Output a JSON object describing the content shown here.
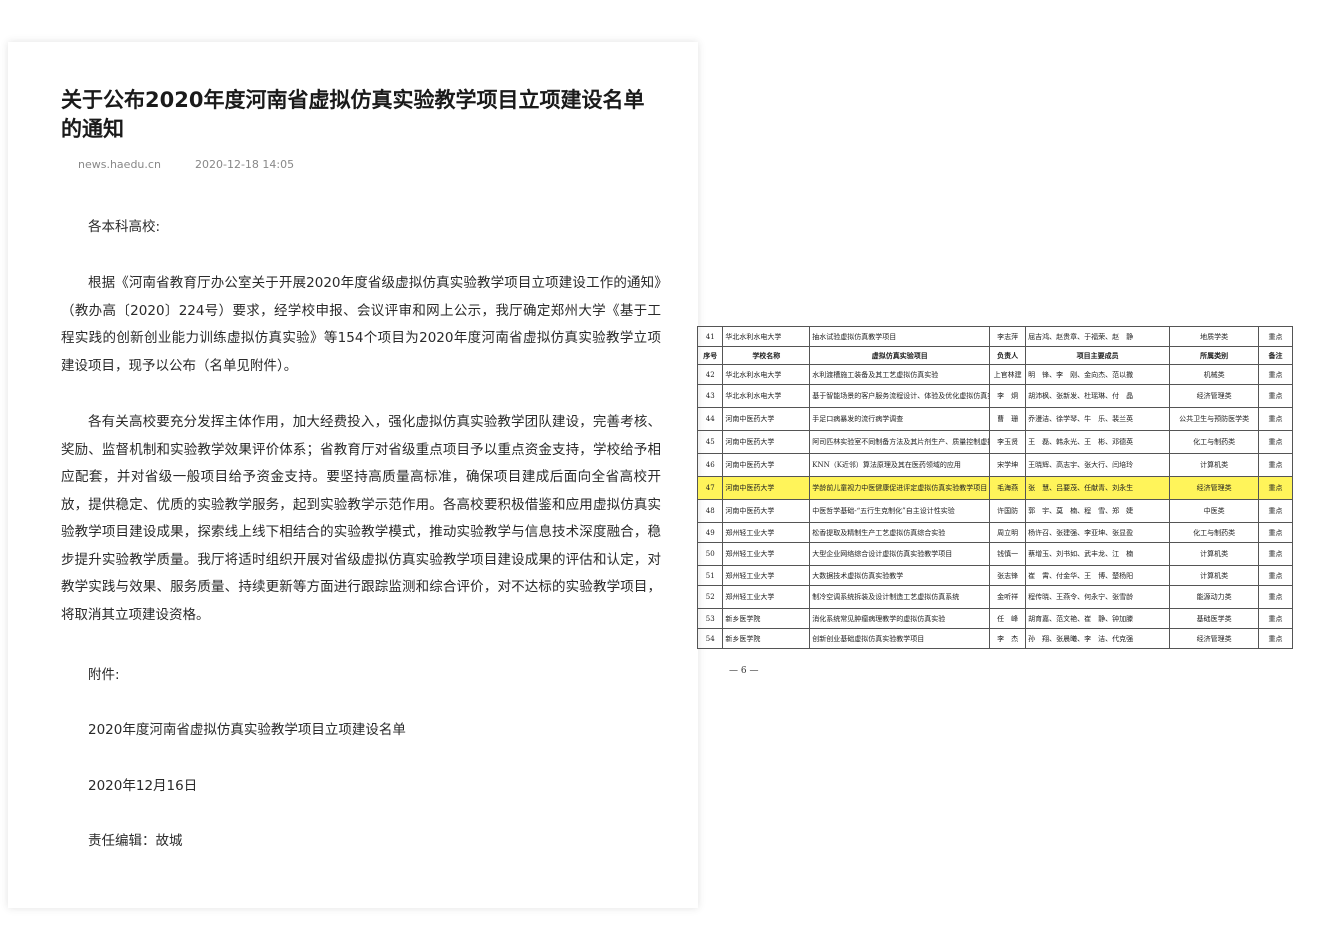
{
  "article": {
    "title": "关于公布2020年度河南省虚拟仿真实验教学项目立项建设名单的通知",
    "source": "news.haedu.cn",
    "datetime": "2020-12-18 14:05",
    "salutation": "各本科高校:",
    "para1": "根据《河南省教育厅办公室关于开展2020年度省级虚拟仿真实验教学项目立项建设工作的通知》（教办高〔2020〕224号）要求，经学校申报、会议评审和网上公示，我厅确定郑州大学《基于工程实践的创新创业能力训练虚拟仿真实验》等154个项目为2020年度河南省虚拟仿真实验教学立项建设项目，现予以公布（名单见附件）。",
    "para2": "各有关高校要充分发挥主体作用，加大经费投入，强化虚拟仿真实验教学团队建设，完善考核、奖励、监督机制和实验教学效果评价体系；省教育厅对省级重点项目予以重点资金支持，学校给予相应配套，并对省级一般项目给予资金支持。要坚持高质量高标准，确保项目建成后面向全省高校开放，提供稳定、优质的实验教学服务，起到实验教学示范作用。各高校要积极借鉴和应用虚拟仿真实验教学项目建设成果，探索线上线下相结合的实验教学模式，推动实验教学与信息技术深度融合，稳步提升实验教学质量。我厅将适时组织开展对省级虚拟仿真实验教学项目建设成果的评估和认定，对教学实践与效果、服务质量、持续更新等方面进行跟踪监测和综合评价，对不达标的实验教学项目，将取消其立项建设资格。",
    "attachment_label": "附件:",
    "attachment_name": "2020年度河南省虚拟仿真实验教学项目立项建设名单",
    "sign_date": "2020年12月16日",
    "editor": "责任编辑：故城"
  },
  "table": {
    "headers": [
      "序号",
      "学校名称",
      "虚拟仿真实验项目",
      "负责人",
      "项目主要成员",
      "所属类别",
      "备注"
    ],
    "top_row": [
      "41",
      "华北水利水电大学",
      "抽水试验虚拟仿真教学项目",
      "李志萍",
      "屈吉鸿、赵贵章、于福荣、赵　静",
      "地质学类",
      "重点"
    ],
    "rows": [
      [
        "42",
        "华北水利水电大学",
        "水利渡槽施工装备及其工艺虚拟仿真实验",
        "上官林建",
        "明　锋、李　刚、金向杰、范以撒",
        "机械类",
        "重点"
      ],
      [
        "43",
        "华北水利水电大学",
        "基于智能场景的客户服务流程设计、体验及优化虚拟仿真实验项目",
        "李　炯",
        "胡沛枫、张新发、杜瑶琳、付　晶",
        "经济管理类",
        "重点"
      ],
      [
        "44",
        "河南中医药大学",
        "手足口病暴发的流行病学调查",
        "曹　珊",
        "乔漫洁、徐学琴、牛　乐、裴兰英",
        "公共卫生与预防医学类",
        "重点"
      ],
      [
        "45",
        "河南中医药大学",
        "阿司匹林实验室不同制备方法及其片剂生产、质量控制虚拟仿真实验",
        "李玉贤",
        "王　磊、韩永光、王　彬、邓德英",
        "化工与制药类",
        "重点"
      ],
      [
        "46",
        "河南中医药大学",
        "KNN（K近邻）算法原理及其在医药领域的应用",
        "宋学坤",
        "王晓辉、高志宇、张大行、闫培玲",
        "计算机类",
        "重点"
      ],
      [
        "47",
        "河南中医药大学",
        "学龄前儿童视力中医健康促进评定虚拟仿真实验教学项目",
        "毛海燕",
        "张　慧、吕要茂、任献青、刘永生",
        "经济管理类",
        "重点"
      ],
      [
        "48",
        "河南中医药大学",
        "中医哲学基础-“五行生克制化”自主设计性实验",
        "许国防",
        "郭　宇、莫　楠、程　雪、郑　婕",
        "中医类",
        "重点"
      ],
      [
        "49",
        "郑州轻工业大学",
        "松香提取及精制生产工艺虚拟仿真综合实验",
        "周立明",
        "杨许召、张建强、李亚坤、张显盈",
        "化工与制药类",
        "重点"
      ],
      [
        "50",
        "郑州轻工业大学",
        "大型企业网络综合设计虚拟仿真实验教学项目",
        "钱慎一",
        "蔡增玉、刘书如、武丰龙、江　楠",
        "计算机类",
        "重点"
      ],
      [
        "51",
        "郑州轻工业大学",
        "大数据技术虚拟仿真实验教学",
        "张志锋",
        "崔　霄、付金华、王　博、楚杨阳",
        "计算机类",
        "重点"
      ],
      [
        "52",
        "郑州轻工业大学",
        "制冷空调系统拆装及设计制造工艺虚拟仿真系统",
        "金听祥",
        "程传晓、王燕令、何永宁、张雪龄",
        "能源动力类",
        "重点"
      ],
      [
        "53",
        "新乡医学院",
        "消化系统常见肿瘤病理教学的虚拟仿真实验",
        "任　峰",
        "胡育嘉、范文艳、崔　静、钟加滕",
        "基础医学类",
        "重点"
      ],
      [
        "54",
        "新乡医学院",
        "创新创业基础虚拟仿真实验教学项目",
        "李　杰",
        "孙　翔、张晨曦、李　洁、代克强",
        "经济管理类",
        "重点"
      ]
    ],
    "highlight_row_no": "47",
    "highlight_color": "#fff45a",
    "page_number": "— 6 —"
  }
}
